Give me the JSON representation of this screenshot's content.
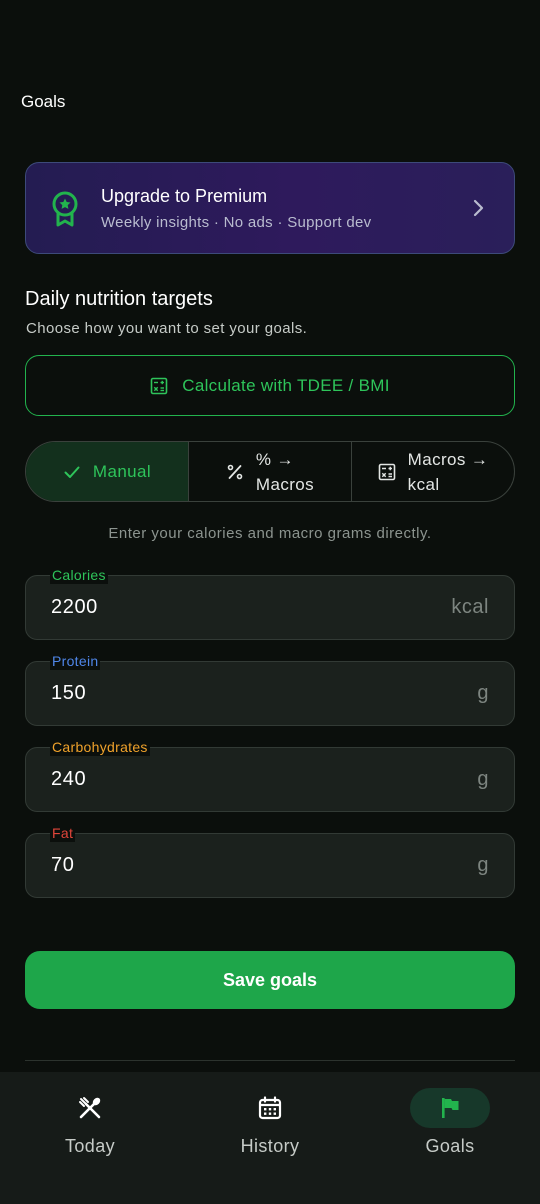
{
  "header": {
    "title": "Goals"
  },
  "premium": {
    "title": "Upgrade to Premium",
    "subtitle": "Weekly insights · No ads · Support dev"
  },
  "targets": {
    "title": "Daily nutrition targets",
    "subtitle": "Choose how you want to set your goals.",
    "tdee_label": "Calculate with TDEE / BMI",
    "modes": [
      {
        "label": "Manual",
        "icon": "check-icon",
        "selected": true
      },
      {
        "label_line1": "% →",
        "label_line2": "Macros",
        "icon": "percent-icon",
        "selected": false
      },
      {
        "label_line1": "Macros →",
        "label_line2": "kcal",
        "icon": "calculator-icon",
        "selected": false
      }
    ],
    "helper": "Enter your calories and macro grams directly."
  },
  "fields": [
    {
      "label": "Calories",
      "value": "2200",
      "unit": "kcal",
      "color": "#2ec45a"
    },
    {
      "label": "Protein",
      "value": "150",
      "unit": "g",
      "color": "#4f86e8"
    },
    {
      "label": "Carbohydrates",
      "value": "240",
      "unit": "g",
      "color": "#f0a22b"
    },
    {
      "label": "Fat",
      "value": "70",
      "unit": "g",
      "color": "#e0453a"
    }
  ],
  "save_label": "Save goals",
  "colors": {
    "accent": "#1ea64a",
    "background": "#0b0f0c",
    "premium_border": "#3d4a7a"
  },
  "nav": [
    {
      "label": "Today",
      "icon": "utensils-icon",
      "active": false
    },
    {
      "label": "History",
      "icon": "calendar-icon",
      "active": false
    },
    {
      "label": "Goals",
      "icon": "flag-icon",
      "active": true
    }
  ]
}
